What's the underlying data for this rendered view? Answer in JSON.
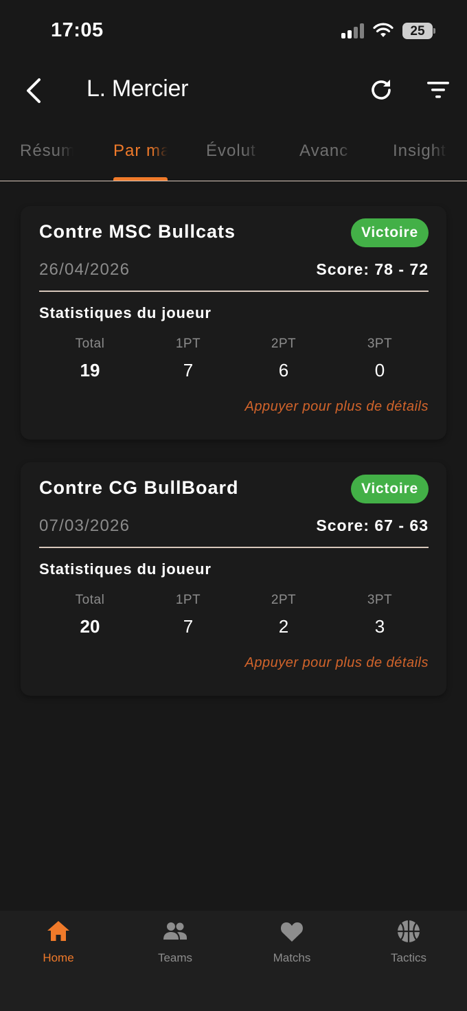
{
  "status_bar": {
    "time": "17:05",
    "battery": "25"
  },
  "header": {
    "title": "L. Mercier",
    "back_icon": "chevron-left-icon",
    "refresh_icon": "refresh-icon",
    "filter_icon": "filter-icon"
  },
  "tabs": [
    {
      "label": "Résum",
      "active": false
    },
    {
      "label": "Par ma",
      "active": true
    },
    {
      "label": "Évolut",
      "active": false
    },
    {
      "label": "Avanc",
      "active": false
    },
    {
      "label": "Insight",
      "active": false
    }
  ],
  "matches": [
    {
      "title": "Contre MSC Bullcats",
      "result": "Victoire",
      "date": "26/04/2026",
      "score": "Score: 78 - 72",
      "stats_title": "Statistiques du joueur",
      "stats": [
        {
          "label": "Total",
          "value": "19"
        },
        {
          "label": "1PT",
          "value": "7"
        },
        {
          "label": "2PT",
          "value": "6"
        },
        {
          "label": "3PT",
          "value": "0"
        }
      ],
      "detail_hint": "Appuyer pour plus de détails"
    },
    {
      "title": "Contre CG BullBoard",
      "result": "Victoire",
      "date": "07/03/2026",
      "score": "Score: 67 - 63",
      "stats_title": "Statistiques du joueur",
      "stats": [
        {
          "label": "Total",
          "value": "20"
        },
        {
          "label": "1PT",
          "value": "7"
        },
        {
          "label": "2PT",
          "value": "2"
        },
        {
          "label": "3PT",
          "value": "3"
        }
      ],
      "detail_hint": "Appuyer pour plus de détails"
    }
  ],
  "bottom_nav": [
    {
      "label": "Home",
      "icon": "home-icon",
      "active": true
    },
    {
      "label": "Teams",
      "icon": "people-icon",
      "active": false
    },
    {
      "label": "Matchs",
      "icon": "heart-icon",
      "active": false
    },
    {
      "label": "Tactics",
      "icon": "basketball-icon",
      "active": false
    }
  ],
  "colors": {
    "background": "#181818",
    "accent": "#f07a2a",
    "victory": "#43b047",
    "muted": "#8c8c8c",
    "divider": "#d8c8bb"
  }
}
